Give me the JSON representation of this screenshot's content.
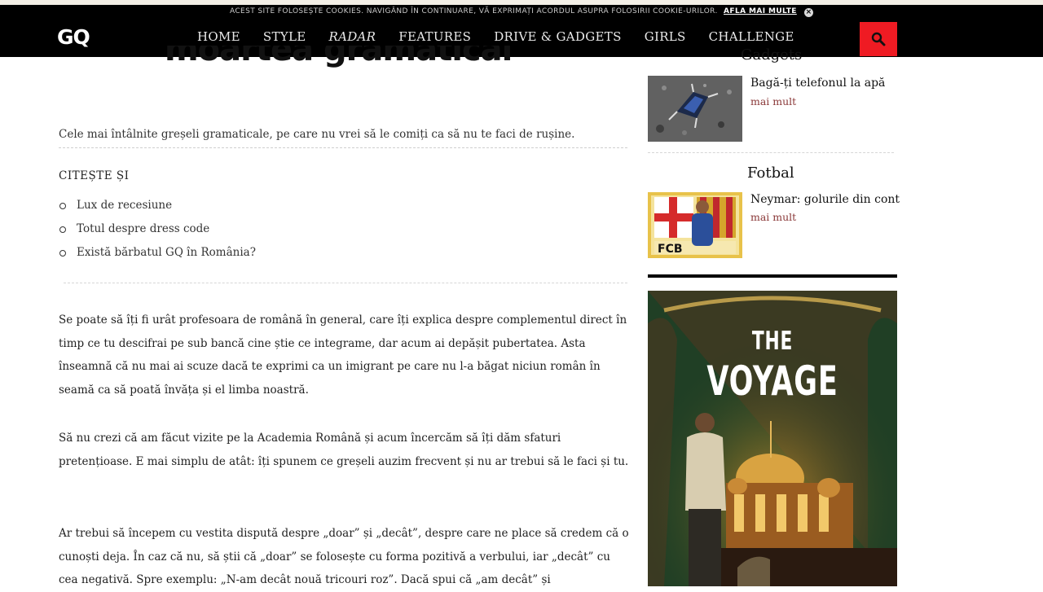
{
  "cookie_bar": {
    "text": "ACEST SITE FOLOSEȘTE COOKIES. NAVIGÂND ÎN CONTINUARE, VĂ EXPRIMAȚI ACORDUL ASUPRA FOLOSIRII COOKIE-URILOR.",
    "link": "AFLA MAI MULTE",
    "close": "×"
  },
  "header": {
    "logo": "GQ",
    "nav": [
      "HOME",
      "STYLE",
      "RADAR",
      "FEATURES",
      "DRIVE & GADGETS",
      "GIRLS",
      "CHALLENGE"
    ]
  },
  "article": {
    "headline": "moartea gramatical",
    "lead": "Cele mai întâlnite greșeli gramaticale, pe care nu vrei să le comiți ca să nu te faci de rușine.",
    "read_also": "CITEȘTE ȘI",
    "related": [
      "Lux de recesiune",
      "Totul despre dress code",
      "Există bărbatul GQ în România?"
    ],
    "paragraphs": [
      "Se poate să îți fi urât profesoara de română în general, care îți explica despre complementul direct în timp ce tu descifrai pe sub bancă cine știe ce integrame, dar acum ai depășit pubertatea. Asta înseamnă că nu mai ai scuze dacă te exprimi ca un imigrant pe care nu l-a băgat niciun român în seamă ca să poată învăța și el limba noastră.",
      "Să nu crezi că am făcut vizite pe la Academia Română și acum încercăm să îți dăm sfaturi pretențioase. E mai simplu de atât: îți spunem ce greșeli auzim frecvent și nu ar trebui să le faci și tu.",
      "Ar trebui să începem cu vestita dispută despre „doar” și „decât”, despre care ne place să credem că o cunoști deja. În caz că nu, să știi că „doar” se folosește cu forma pozitivă a verbului, iar „decât” cu cea negativă. Spre exemplu: „N-am decât nouă tricouri roz”. Dacă spui că „am decât” și"
    ]
  },
  "sidebar": {
    "sections": [
      {
        "title": "Gadgets",
        "headline": "Bagă-ți telefonul la apă",
        "more": "mai mult"
      },
      {
        "title": "Fotbal",
        "headline": "Neymar: golurile din cont",
        "more": "mai mult"
      }
    ],
    "ad": {
      "line1": "THE",
      "line2": "VOYAGE"
    }
  },
  "colors": {
    "header_bg": "#000000",
    "search_bg": "#ef1b23",
    "more_link": "#8a3838"
  }
}
